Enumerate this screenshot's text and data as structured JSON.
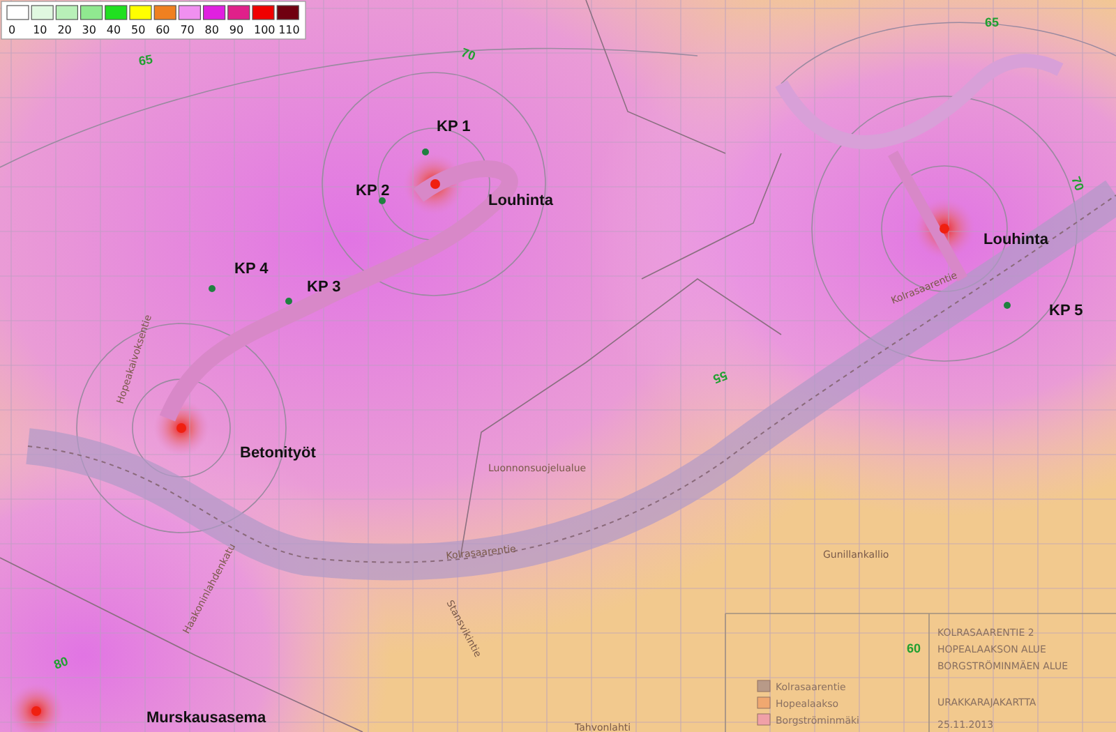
{
  "legend": {
    "scale": [
      {
        "label": "0",
        "color": "#ffffff"
      },
      {
        "label": "10",
        "color": "#e0f8e0"
      },
      {
        "label": "20",
        "color": "#b8f0b8"
      },
      {
        "label": "30",
        "color": "#90e890"
      },
      {
        "label": "40",
        "color": "#20e020"
      },
      {
        "label": "50",
        "color": "#ffff00"
      },
      {
        "label": "60",
        "color": "#f08020"
      },
      {
        "label": "70",
        "color": "#f090f0"
      },
      {
        "label": "80",
        "color": "#e020e0"
      },
      {
        "label": "90",
        "color": "#e0208a"
      },
      {
        "label": "100",
        "color": "#f00000"
      },
      {
        "label": "110",
        "color": "#700010"
      }
    ]
  },
  "map_labels": [
    {
      "kind": "contour",
      "text": "65"
    },
    {
      "kind": "contour",
      "text": "70"
    },
    {
      "kind": "contour",
      "text": "65"
    },
    {
      "kind": "measurement_point",
      "text": "KP 1"
    },
    {
      "kind": "contour",
      "text": "70"
    },
    {
      "kind": "measurement_point",
      "text": "KP 2"
    },
    {
      "kind": "noise_source",
      "text": "Louhinta"
    },
    {
      "kind": "noise_source",
      "text": "Louhinta"
    },
    {
      "kind": "measurement_point",
      "text": "KP 4"
    },
    {
      "kind": "measurement_point",
      "text": "KP 3"
    },
    {
      "kind": "measurement_point",
      "text": "KP 5"
    },
    {
      "kind": "street",
      "text": "Kolrasaarentie"
    },
    {
      "kind": "street",
      "text": "Hopeakaivoksentie"
    },
    {
      "kind": "contour",
      "text": "55"
    },
    {
      "kind": "noise_source",
      "text": "Betonityöt"
    },
    {
      "kind": "street",
      "text": "Luonnonsuojelualue"
    },
    {
      "kind": "street",
      "text": "Kolrasaarentie"
    },
    {
      "kind": "street",
      "text": "Gunillankallio"
    },
    {
      "kind": "street",
      "text": "Haakoninlahdenkatu"
    },
    {
      "kind": "street",
      "text": "Stansvikintie"
    },
    {
      "kind": "contour",
      "text": "60"
    },
    {
      "kind": "contour",
      "text": "80"
    },
    {
      "kind": "noise_source",
      "text": "Murskausasema"
    },
    {
      "kind": "street",
      "text": "Tahvonlahti"
    }
  ],
  "title_block": {
    "lines": [
      "KOLRASAARENTIE 2",
      "HOPEALAAKSON ALUE",
      "BORGSTRÖMINMÄEN ALUE"
    ],
    "map_name": "URAKKARAJAKARTTA",
    "date": "25.11.2013",
    "areas": [
      {
        "label": "Kolrasaarentie",
        "color": "#b89a88"
      },
      {
        "label": "Hopealaakso",
        "color": "#f0a870"
      },
      {
        "label": "Borgströminmäki",
        "color": "#f0a0a8"
      }
    ]
  }
}
